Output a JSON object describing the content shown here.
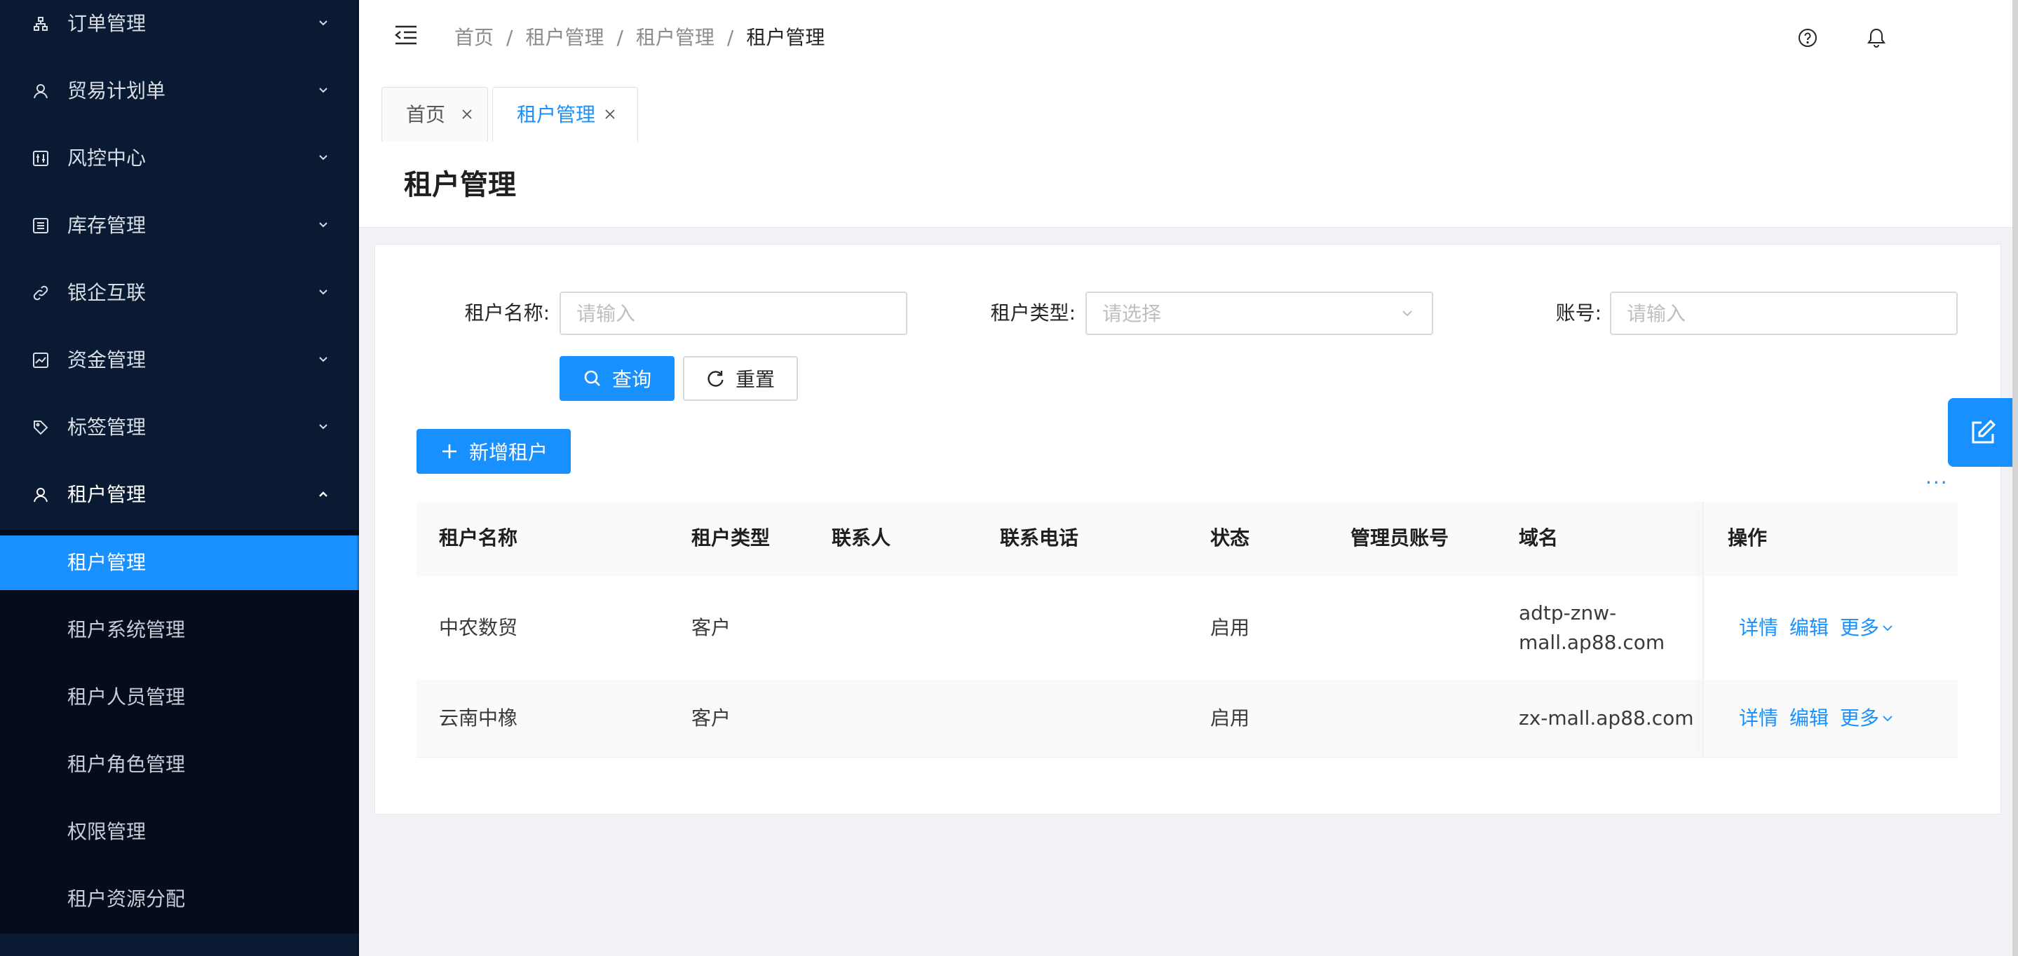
{
  "sidebar": {
    "menu": [
      {
        "label": "订单管理",
        "icon": "sitemap-icon"
      },
      {
        "label": "贸易计划单",
        "icon": "user-icon"
      },
      {
        "label": "风控中心",
        "icon": "sliders-icon"
      },
      {
        "label": "库存管理",
        "icon": "list-icon"
      },
      {
        "label": "银企互联",
        "icon": "link-icon"
      },
      {
        "label": "资金管理",
        "icon": "line-chart-icon"
      },
      {
        "label": "标签管理",
        "icon": "tag-icon"
      },
      {
        "label": "租户管理",
        "icon": "user-icon"
      }
    ],
    "submenu": [
      {
        "label": "租户管理"
      },
      {
        "label": "租户系统管理"
      },
      {
        "label": "租户人员管理"
      },
      {
        "label": "租户角色管理"
      },
      {
        "label": "权限管理"
      },
      {
        "label": "租户资源分配"
      }
    ]
  },
  "breadcrumb": [
    "首页",
    "租户管理",
    "租户管理",
    "租户管理"
  ],
  "breadcrumb_sep": "/",
  "tabs": [
    {
      "label": "首页"
    },
    {
      "label": "租户管理"
    }
  ],
  "page_title": "租户管理",
  "search": {
    "tenant_name_label": "租户名称:",
    "tenant_name_placeholder": "请输入",
    "tenant_type_label": "租户类型:",
    "tenant_type_placeholder": "请选择",
    "account_label": "账号:",
    "account_placeholder": "请输入",
    "query_label": "查询",
    "reset_label": "重置"
  },
  "add_tenant_label": "新增租户",
  "more_dots": "···",
  "table": {
    "headers": [
      "租户名称",
      "租户类型",
      "联系人",
      "联系电话",
      "状态",
      "管理员账号",
      "域名",
      "操作"
    ],
    "rows": [
      {
        "name": "中农数贸",
        "type": "客户",
        "contact": "",
        "phone": "",
        "status": "启用",
        "admin": "",
        "domain_line1": "adtp-znw-",
        "domain_line2": "mall.ap88.com"
      },
      {
        "name": "云南中橡",
        "type": "客户",
        "contact": "",
        "phone": "",
        "status": "启用",
        "admin": "",
        "domain_line1": "zx-mall.ap88.com",
        "domain_line2": ""
      }
    ],
    "actions": {
      "detail": "详情",
      "edit": "编辑",
      "more": "更多"
    }
  },
  "colors": {
    "primary": "#1890ff",
    "sidebar": "#0b1a33"
  }
}
